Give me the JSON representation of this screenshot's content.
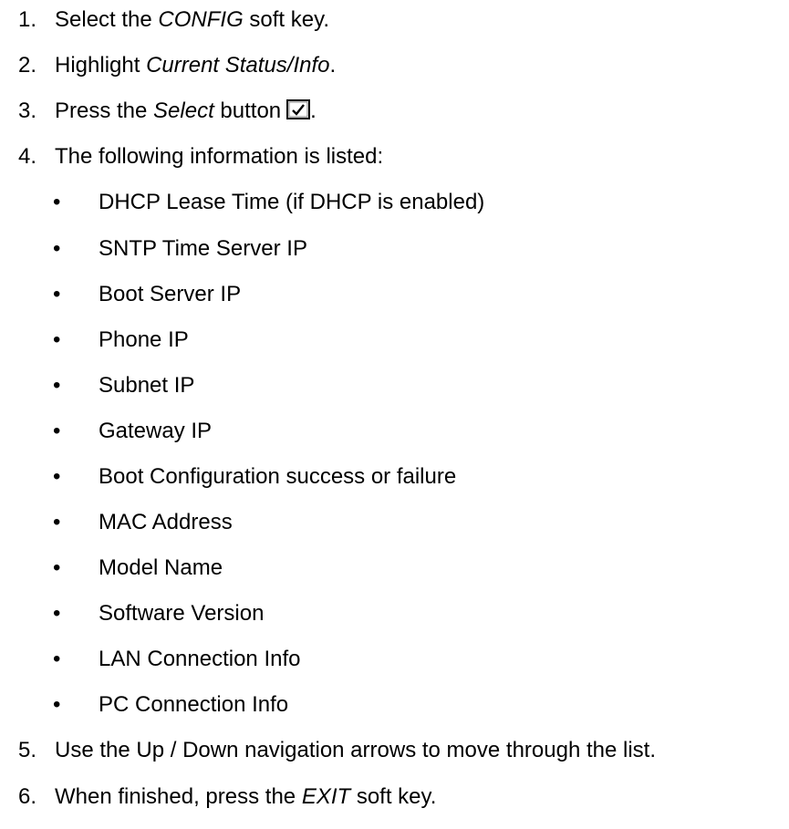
{
  "steps": [
    {
      "number": "1.",
      "pre": "Select the ",
      "em": "CONFIG",
      "post": " soft key."
    },
    {
      "number": "2.",
      "pre": "Highlight ",
      "em": "Current Status/Info",
      "post": "."
    },
    {
      "number": "3.",
      "pre": "Press the ",
      "em": "Select",
      "post": " button",
      "tail": ".",
      "icon": "select-checkmark-icon"
    },
    {
      "number": "4.",
      "text": "The following information is listed:"
    },
    {
      "number": "5.",
      "text": "Use the Up / Down navigation arrows to move through the list."
    },
    {
      "number": "6.",
      "pre": "When finished, press the ",
      "em": "EXIT",
      "post": " soft key."
    }
  ],
  "bullet_symbol": "•",
  "info_items": [
    "DHCP Lease Time (if DHCP is enabled)",
    "SNTP Time Server IP",
    "Boot Server IP",
    "Phone IP",
    "Subnet IP",
    "Gateway IP",
    "Boot Configuration success or failure",
    "MAC Address",
    "Model Name",
    "Software Version",
    "LAN Connection Info",
    "PC Connection Info"
  ]
}
